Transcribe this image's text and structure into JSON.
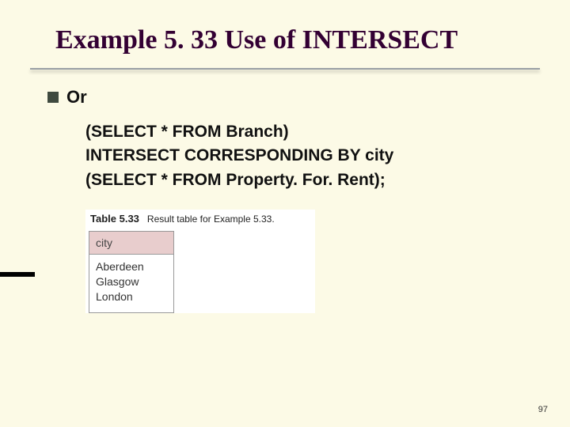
{
  "title": "Example 5. 33  Use of INTERSECT",
  "bullet": "Or",
  "code": {
    "line1": "(SELECT * FROM Branch)",
    "line2": "INTERSECT CORRESPONDING BY city",
    "line3": "(SELECT * FROM Property. For. Rent);"
  },
  "table": {
    "label": "Table 5.33",
    "caption": "Result table for Example 5.33.",
    "header": "city",
    "rows": [
      "Aberdeen",
      "Glasgow",
      "London"
    ]
  },
  "page_number": "97",
  "chart_data": {
    "type": "table",
    "title": "Table 5.33 Result table for Example 5.33.",
    "columns": [
      "city"
    ],
    "rows": [
      [
        "Aberdeen"
      ],
      [
        "Glasgow"
      ],
      [
        "London"
      ]
    ]
  }
}
